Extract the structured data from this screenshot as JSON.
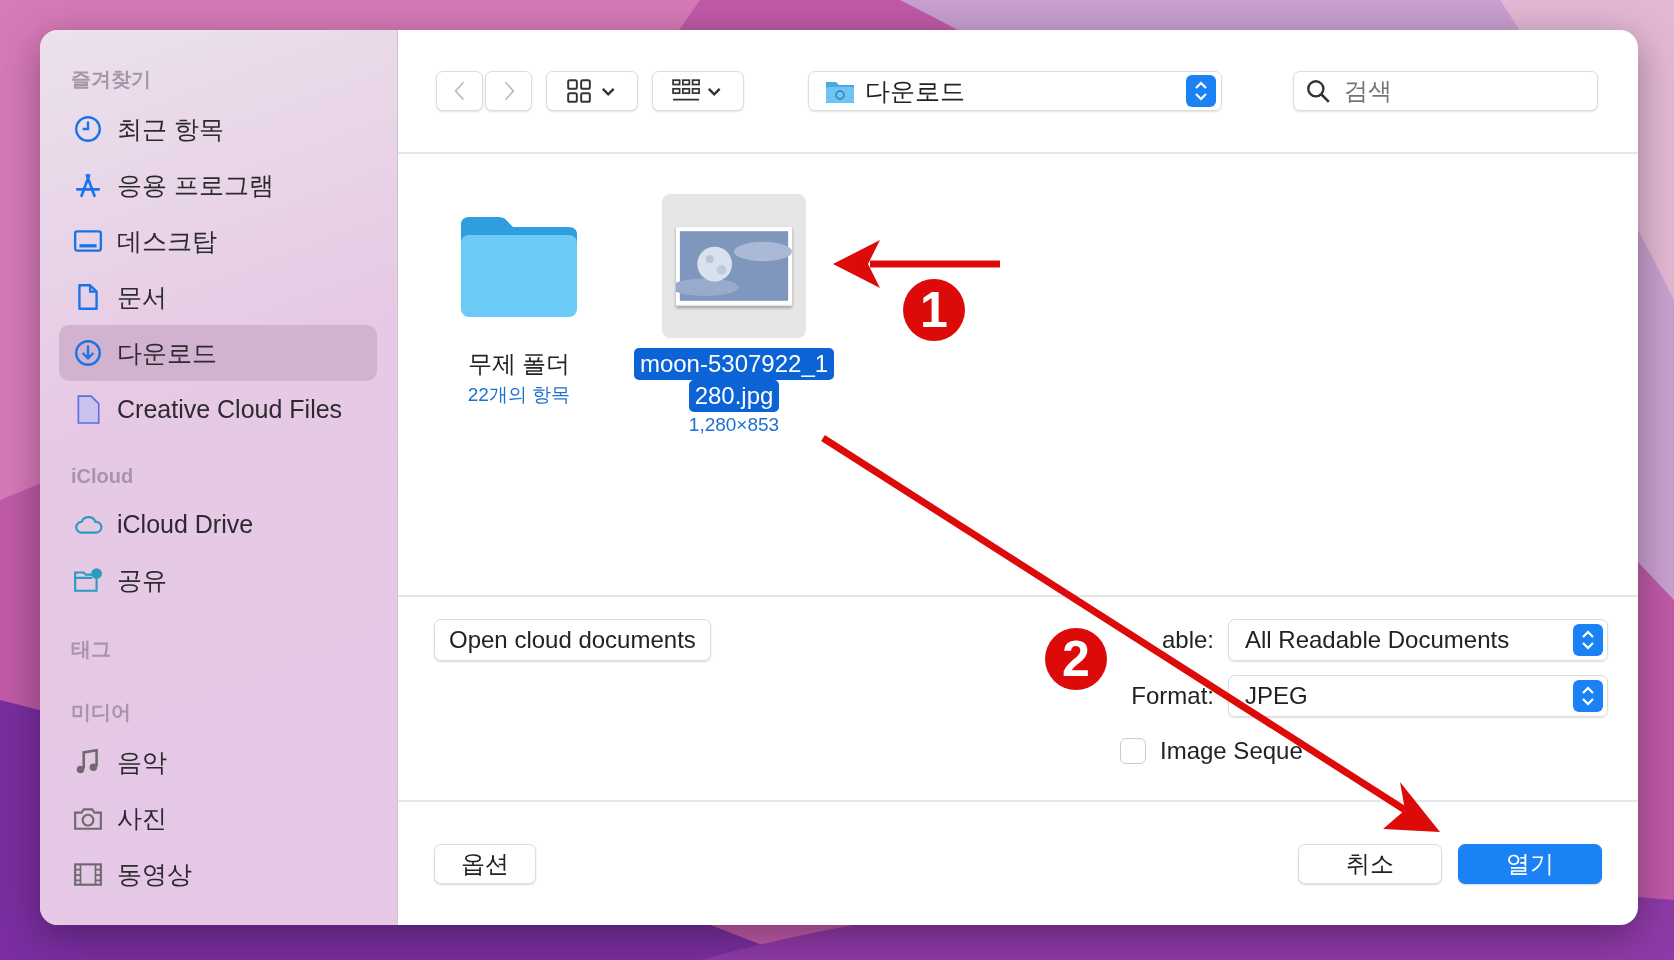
{
  "sidebar": {
    "sections": [
      {
        "title": "즐겨찾기",
        "items": [
          {
            "label": "최근 항목",
            "selected": false
          },
          {
            "label": "응용 프로그램",
            "selected": false
          },
          {
            "label": "데스크탑",
            "selected": false
          },
          {
            "label": "문서",
            "selected": false
          },
          {
            "label": "다운로드",
            "selected": true
          },
          {
            "label": "Creative Cloud Files",
            "selected": false
          }
        ]
      },
      {
        "title": "iCloud",
        "items": [
          {
            "label": "iCloud Drive",
            "selected": false
          },
          {
            "label": "공유",
            "selected": false
          }
        ]
      },
      {
        "title": "태그"
      },
      {
        "title": "미디어",
        "items": [
          {
            "label": "음악",
            "selected": false
          },
          {
            "label": "사진",
            "selected": false
          },
          {
            "label": "동영상",
            "selected": false
          }
        ]
      }
    ]
  },
  "toolbar": {
    "nav": [
      {
        "kind": "back",
        "disabled": true
      },
      {
        "kind": "forward",
        "disabled": true
      }
    ],
    "location": "다운로드",
    "search": {
      "placeholder": "검색"
    }
  },
  "files": [
    {
      "kind": "folder",
      "name_lines": [
        "무제 폴더"
      ],
      "detail": "22개의 항목",
      "selected": false
    },
    {
      "name_lines": [
        "moon-5307922_1",
        "280.jpg"
      ],
      "detail": "1,280×853",
      "selected": true
    }
  ],
  "options": {
    "cloud_button": "Open cloud documents",
    "popups": [
      {
        "label": "able:",
        "value": "All Readable Documents"
      },
      {
        "label": "Format:",
        "value": "JPEG"
      }
    ],
    "checkbox": {
      "label": "Image Seque",
      "checked": false
    }
  },
  "footer": {
    "options_button": "옵션",
    "cancel_button": "취소",
    "open_button": "열기"
  },
  "annotations": [
    {
      "number": "1"
    },
    {
      "number": "2"
    }
  ]
}
